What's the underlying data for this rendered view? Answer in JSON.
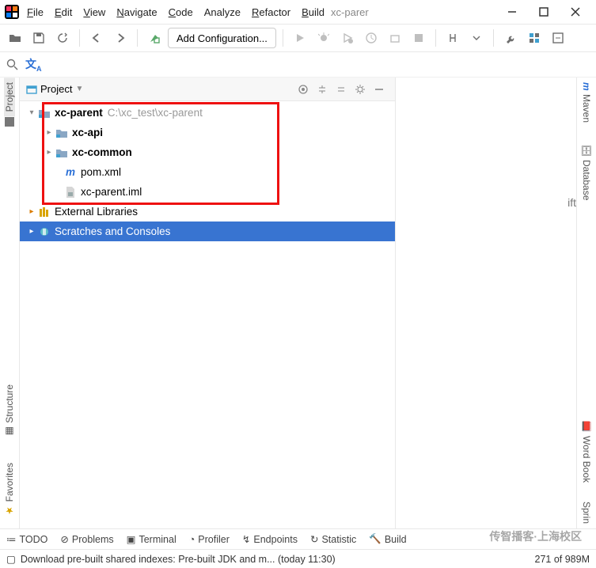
{
  "menu": {
    "file": "File",
    "edit": "Edit",
    "view": "View",
    "navigate": "Navigate",
    "code": "Code",
    "analyze": "Analyze",
    "refactor": "Refactor",
    "build": "Build"
  },
  "title_project": "xc-parer",
  "toolbar": {
    "config_label": "Add Configuration..."
  },
  "panel": {
    "title": "Project"
  },
  "tree": {
    "root": {
      "name": "xc-parent",
      "path": "C:\\xc_test\\xc-parent"
    },
    "children": [
      {
        "name": "xc-api",
        "type": "module"
      },
      {
        "name": "xc-common",
        "type": "module"
      },
      {
        "name": "pom.xml",
        "type": "maven"
      },
      {
        "name": "xc-parent.iml",
        "type": "iml"
      }
    ],
    "ext_lib": "External Libraries",
    "scratches": "Scratches and Consoles"
  },
  "editor_hint": "ift",
  "left_tabs": [
    "Project",
    "Structure",
    "Favorites"
  ],
  "right_tabs": [
    "Maven",
    "Database",
    "Word Book",
    "Sprin"
  ],
  "bottom": {
    "todo": "TODO",
    "problems": "Problems",
    "terminal": "Terminal",
    "profiler": "Profiler",
    "endpoints": "Endpoints",
    "statistic": "Statistic",
    "build": "Build"
  },
  "status": {
    "msg": "Download pre-built shared indexes: Pre-built JDK and m... (today 11:30)",
    "mem": "271 of 989M"
  },
  "watermark": "传智播客·上海校区"
}
